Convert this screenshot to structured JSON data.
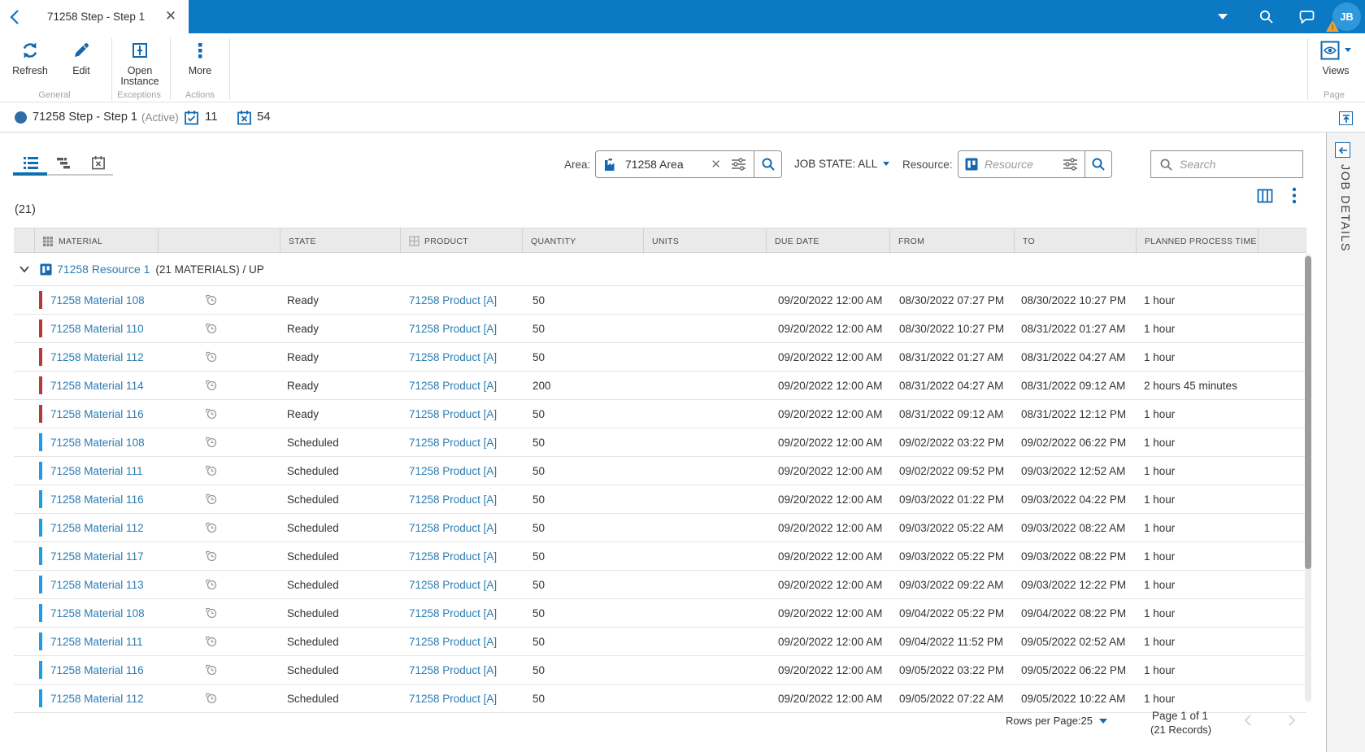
{
  "titlebar": {
    "tab_title": "71258 Step - Step 1",
    "avatar_initials": "JB"
  },
  "ribbon": {
    "refresh_label": "Refresh",
    "edit_label": "Edit",
    "open_instance_label": "Open Instance",
    "more_label": "More",
    "views_label": "Views",
    "group_general": "General",
    "group_exceptions": "Exceptions",
    "group_actions": "Actions",
    "group_page": "Page"
  },
  "status": {
    "title": "71258 Step - Step 1",
    "state": "(Active)",
    "ok_count": "11",
    "error_count": "54"
  },
  "filters": {
    "area_label": "Area:",
    "area_value": "71258 Area",
    "job_state_label": "JOB STATE: ALL",
    "resource_label": "Resource:",
    "resource_placeholder": "Resource",
    "search_placeholder": "Search"
  },
  "table": {
    "count": "(21)",
    "columns": [
      "MATERIAL",
      "",
      "STATE",
      "PRODUCT",
      "QUANTITY",
      "UNITS",
      "DUE DATE",
      "FROM",
      "TO",
      "PLANNED PROCESS TIME"
    ],
    "group": {
      "name": "71258 Resource 1",
      "suffix": "(21 MATERIALS) / UP"
    },
    "rows": [
      {
        "material": "71258 Material 108",
        "bar": "ready",
        "state": "Ready",
        "product": "71258 Product [A]",
        "quantity": "50",
        "due": "09/20/2022 12:00 AM",
        "from": "08/30/2022 07:27 PM",
        "to": "08/30/2022 10:27 PM",
        "planned": "1 hour"
      },
      {
        "material": "71258 Material 110",
        "bar": "ready",
        "state": "Ready",
        "product": "71258 Product [A]",
        "quantity": "50",
        "due": "09/20/2022 12:00 AM",
        "from": "08/30/2022 10:27 PM",
        "to": "08/31/2022 01:27 AM",
        "planned": "1 hour"
      },
      {
        "material": "71258 Material 112",
        "bar": "ready",
        "state": "Ready",
        "product": "71258 Product [A]",
        "quantity": "50",
        "due": "09/20/2022 12:00 AM",
        "from": "08/31/2022 01:27 AM",
        "to": "08/31/2022 04:27 AM",
        "planned": "1 hour"
      },
      {
        "material": "71258 Material 114",
        "bar": "ready",
        "state": "Ready",
        "product": "71258 Product [A]",
        "quantity": "200",
        "due": "09/20/2022 12:00 AM",
        "from": "08/31/2022 04:27 AM",
        "to": "08/31/2022 09:12 AM",
        "planned": "2 hours 45 minutes"
      },
      {
        "material": "71258 Material 116",
        "bar": "ready",
        "state": "Ready",
        "product": "71258 Product [A]",
        "quantity": "50",
        "due": "09/20/2022 12:00 AM",
        "from": "08/31/2022 09:12 AM",
        "to": "08/31/2022 12:12 PM",
        "planned": "1 hour"
      },
      {
        "material": "71258 Material 108",
        "bar": "scheduled",
        "state": "Scheduled",
        "product": "71258 Product [A]",
        "quantity": "50",
        "due": "09/20/2022 12:00 AM",
        "from": "09/02/2022 03:22 PM",
        "to": "09/02/2022 06:22 PM",
        "planned": "1 hour"
      },
      {
        "material": "71258 Material 111",
        "bar": "scheduled",
        "state": "Scheduled",
        "product": "71258 Product [A]",
        "quantity": "50",
        "due": "09/20/2022 12:00 AM",
        "from": "09/02/2022 09:52 PM",
        "to": "09/03/2022 12:52 AM",
        "planned": "1 hour"
      },
      {
        "material": "71258 Material 116",
        "bar": "scheduled",
        "state": "Scheduled",
        "product": "71258 Product [A]",
        "quantity": "50",
        "due": "09/20/2022 12:00 AM",
        "from": "09/03/2022 01:22 PM",
        "to": "09/03/2022 04:22 PM",
        "planned": "1 hour"
      },
      {
        "material": "71258 Material 112",
        "bar": "scheduled",
        "state": "Scheduled",
        "product": "71258 Product [A]",
        "quantity": "50",
        "due": "09/20/2022 12:00 AM",
        "from": "09/03/2022 05:22 AM",
        "to": "09/03/2022 08:22 AM",
        "planned": "1 hour"
      },
      {
        "material": "71258 Material 117",
        "bar": "scheduled",
        "state": "Scheduled",
        "product": "71258 Product [A]",
        "quantity": "50",
        "due": "09/20/2022 12:00 AM",
        "from": "09/03/2022 05:22 PM",
        "to": "09/03/2022 08:22 PM",
        "planned": "1 hour"
      },
      {
        "material": "71258 Material 113",
        "bar": "scheduled",
        "state": "Scheduled",
        "product": "71258 Product [A]",
        "quantity": "50",
        "due": "09/20/2022 12:00 AM",
        "from": "09/03/2022 09:22 AM",
        "to": "09/03/2022 12:22 PM",
        "planned": "1 hour"
      },
      {
        "material": "71258 Material 108",
        "bar": "scheduled",
        "state": "Scheduled",
        "product": "71258 Product [A]",
        "quantity": "50",
        "due": "09/20/2022 12:00 AM",
        "from": "09/04/2022 05:22 PM",
        "to": "09/04/2022 08:22 PM",
        "planned": "1 hour"
      },
      {
        "material": "71258 Material 111",
        "bar": "scheduled",
        "state": "Scheduled",
        "product": "71258 Product [A]",
        "quantity": "50",
        "due": "09/20/2022 12:00 AM",
        "from": "09/04/2022 11:52 PM",
        "to": "09/05/2022 02:52 AM",
        "planned": "1 hour"
      },
      {
        "material": "71258 Material 116",
        "bar": "scheduled",
        "state": "Scheduled",
        "product": "71258 Product [A]",
        "quantity": "50",
        "due": "09/20/2022 12:00 AM",
        "from": "09/05/2022 03:22 PM",
        "to": "09/05/2022 06:22 PM",
        "planned": "1 hour"
      },
      {
        "material": "71258 Material 112",
        "bar": "scheduled",
        "state": "Scheduled",
        "product": "71258 Product [A]",
        "quantity": "50",
        "due": "09/20/2022 12:00 AM",
        "from": "09/05/2022 07:22 AM",
        "to": "09/05/2022 10:22 AM",
        "planned": "1 hour"
      }
    ]
  },
  "footer": {
    "rows_per_page": "Rows per Page:25",
    "page": "Page 1 of 1",
    "records": "(21 Records)"
  },
  "sidebar": {
    "title": "JOB DETAILS"
  },
  "colors": {
    "topbar": "#0b79c4",
    "accent": "#1269b0",
    "link": "#2b7cb0",
    "ready_bar": "#b23b3b",
    "scheduled_bar": "#1e9be2"
  }
}
